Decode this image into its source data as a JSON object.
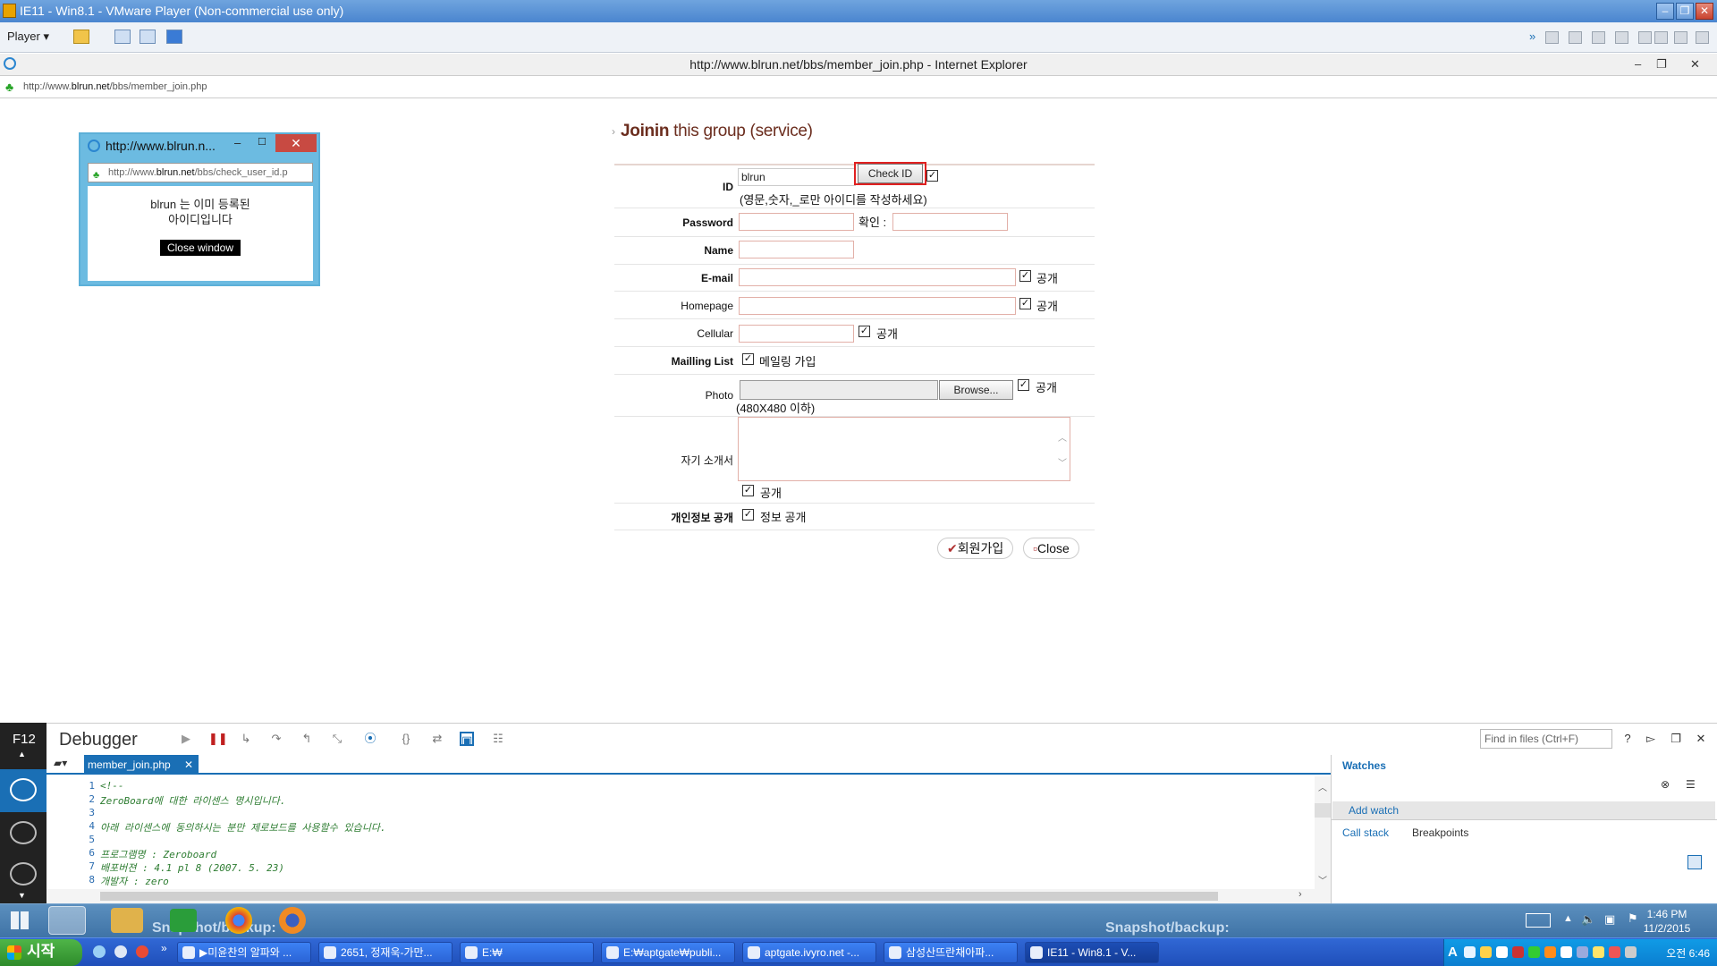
{
  "vmware": {
    "title": "IE11 - Win8.1 - VMware Player (Non-commercial use only)",
    "player_menu": "Player"
  },
  "ie": {
    "title": "http://www.blrun.net/bbs/member_join.php - Internet Explorer",
    "address_prefix": "http://www.",
    "address_domain": "blrun.net",
    "address_path": "/bbs/member_join.php"
  },
  "popup": {
    "title": "http://www.blrun.n...",
    "address_prefix": "http://www.",
    "address_domain": "blrun.net",
    "address_path": "/bbs/check_user_id.p",
    "message_line1": "blrun 는 이미 등록된",
    "message_line2": "아이디입니다",
    "close_button": "Close window"
  },
  "form": {
    "heading_bold": "Joinin",
    "heading_rest": " this group (service)",
    "id_label": "ID",
    "id_value": "blrun",
    "check_id_button": "Check ID",
    "id_hint": "(영문,숫자,_로만 아이디를 작성하세요)",
    "password_label": "Password",
    "confirm_label": "확인 :",
    "name_label": "Name",
    "email_label": "E-mail",
    "homepage_label": "Homepage",
    "cellular_label": "Cellular",
    "mailing_label": "Mailling List",
    "mailing_option": "메일링 가입",
    "photo_label": "Photo",
    "browse_button": "Browse...",
    "photo_hint": "(480X480 이하)",
    "intro_label": "자기 소개서",
    "privacy_label": "개인정보 공개",
    "privacy_option": "정보 공개",
    "public_label": "공개",
    "join_button": "회원가입",
    "close_button": "Close"
  },
  "debugger": {
    "f12_label": "F12",
    "title": "Debugger",
    "find_placeholder": "Find in files (Ctrl+F)",
    "file_tab": "member_join.php",
    "code_lines": [
      {
        "n": "1",
        "t": "<!--"
      },
      {
        "n": "2",
        "t": "ZeroBoard에 대한 라이센스 명시입니다."
      },
      {
        "n": "3",
        "t": ""
      },
      {
        "n": "4",
        "t": "아래 라이센스에 동의하시는 분만 제로보드를 사용할수 있습니다."
      },
      {
        "n": "5",
        "t": ""
      },
      {
        "n": "6",
        "t": "프로그램명 : Zeroboard"
      },
      {
        "n": "7",
        "t": "배포버젼 : 4.1 pl 8 (2007. 5. 23)"
      },
      {
        "n": "8",
        "t": "개발자 : zero"
      }
    ],
    "watches_label": "Watches",
    "add_watch": "Add watch",
    "call_stack_tab": "Call stack",
    "breakpoints_tab": "Breakpoints"
  },
  "taskbar": {
    "snapshot_left": "Snapshot/backup:",
    "snapshot_right": "Snapshot/backup:",
    "time": "1:46 PM",
    "date": "11/2/2015"
  },
  "xp_taskbar": {
    "start": "시작",
    "buttons": [
      "▶미윤찬의 알파와 ...",
      "2651, 정재욱-가만...",
      "E:₩",
      "E:₩aptgate₩publi...",
      "aptgate.ivyro.net -...",
      "삼성산뜨란채아파...",
      "IE11 - Win8.1 - V..."
    ],
    "tray_time": "오전 6:46"
  },
  "colors": {
    "accent": "#1a6fb5",
    "heading": "#6b2d1e",
    "highlight": "#e02020"
  }
}
